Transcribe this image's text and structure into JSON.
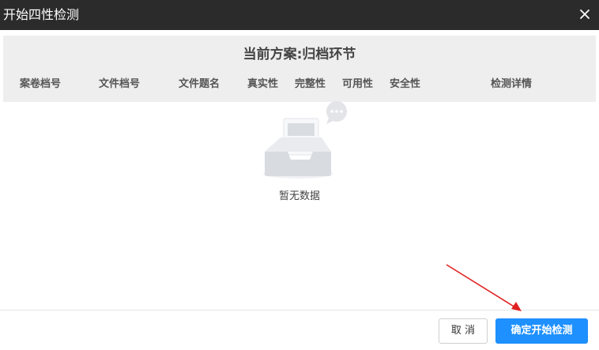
{
  "dialog": {
    "title": "开始四性检测"
  },
  "table": {
    "scheme_title": "当前方案:归档环节",
    "columns": [
      "案卷档号",
      "文件档号",
      "文件题名",
      "真实性",
      "完整性",
      "可用性",
      "安全性",
      "检测详情"
    ]
  },
  "empty_state": {
    "text": "暂无数据"
  },
  "footer": {
    "cancel_label": "取 消",
    "confirm_label": "确定开始检测"
  },
  "colors": {
    "titlebar": "#2b2b2b",
    "primary": "#1e90ff",
    "annotation_arrow": "#e02020"
  }
}
